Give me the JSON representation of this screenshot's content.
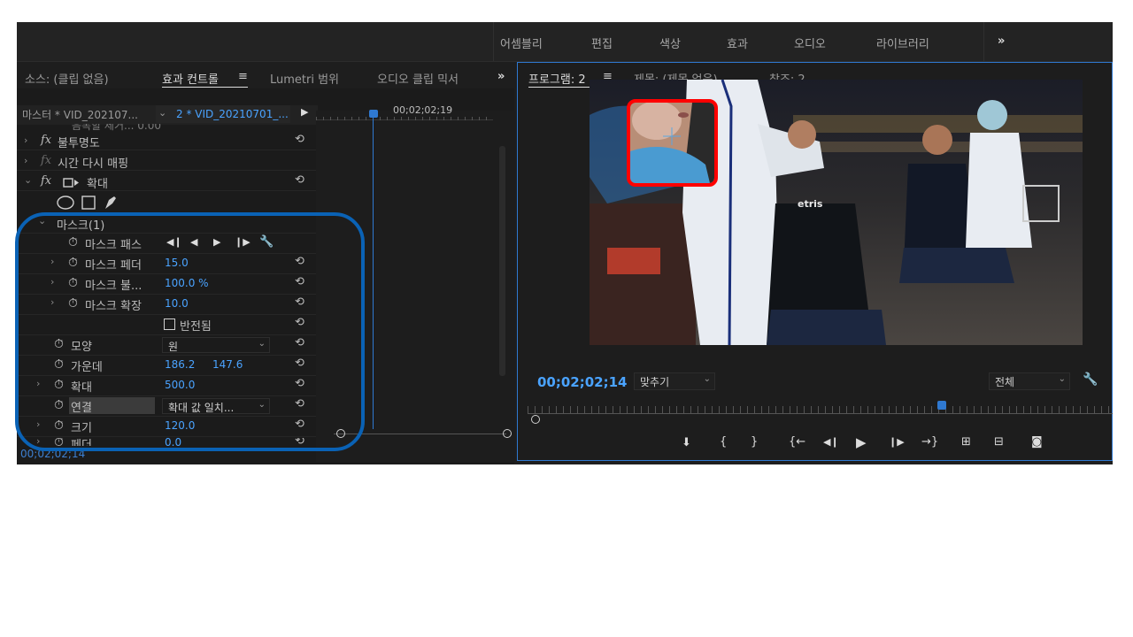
{
  "workspaces": [
    "어셈블리",
    "편집",
    "색상",
    "효과",
    "오디오",
    "라이브러리"
  ],
  "tabs": {
    "source": "소스: (클립 없음)",
    "effect_controls": "효과 컨트롤",
    "lumetri": "Lumetri 범위",
    "audio_mixer": "오디오 클립 믹서",
    "program": "프로그램: 2",
    "title": "제목: (제목 없음)",
    "reference": "참조: 2"
  },
  "effect_controls": {
    "master_clip": "마스터 * VID_202107...",
    "sequence_clip": "2 * VID_20210701_...",
    "timecode_head": "00;02;02;19",
    "partial_row": "음복할 제거... 0.00",
    "opacity": "불투명도",
    "time_remap": "시간 다시 매핑",
    "magnify": "확대",
    "mask_group": "마스크(1)",
    "mask_path": "마스크 패스",
    "mask_feather": {
      "label": "마스크 페더",
      "value": "15.0"
    },
    "mask_opacity": {
      "label": "마스크 불...",
      "value": "100.0 %"
    },
    "mask_expansion": {
      "label": "마스크 확장",
      "value": "10.0"
    },
    "inverted": "반전됨",
    "shape": {
      "label": "모양",
      "value": "원"
    },
    "center": {
      "label": "가운데",
      "x": "186.2",
      "y": "147.6"
    },
    "magnification": {
      "label": "확대",
      "value": "500.0"
    },
    "link": {
      "label": "연결",
      "value": "확대 값 일치..."
    },
    "size": {
      "label": "크기",
      "value": "120.0"
    },
    "feather": {
      "label": "페더",
      "value": "0.0"
    },
    "bottom_timecode": "00;02;02;14"
  },
  "program": {
    "timecode": "00;02;02;14",
    "fit": "맞추기",
    "quality": "전체"
  },
  "video_text": "etris",
  "colors": {
    "accent": "#2f79d1",
    "value_blue": "#4aa3ff",
    "highlight_blue": "#0a62b5",
    "highlight_red": "#ff0000"
  }
}
